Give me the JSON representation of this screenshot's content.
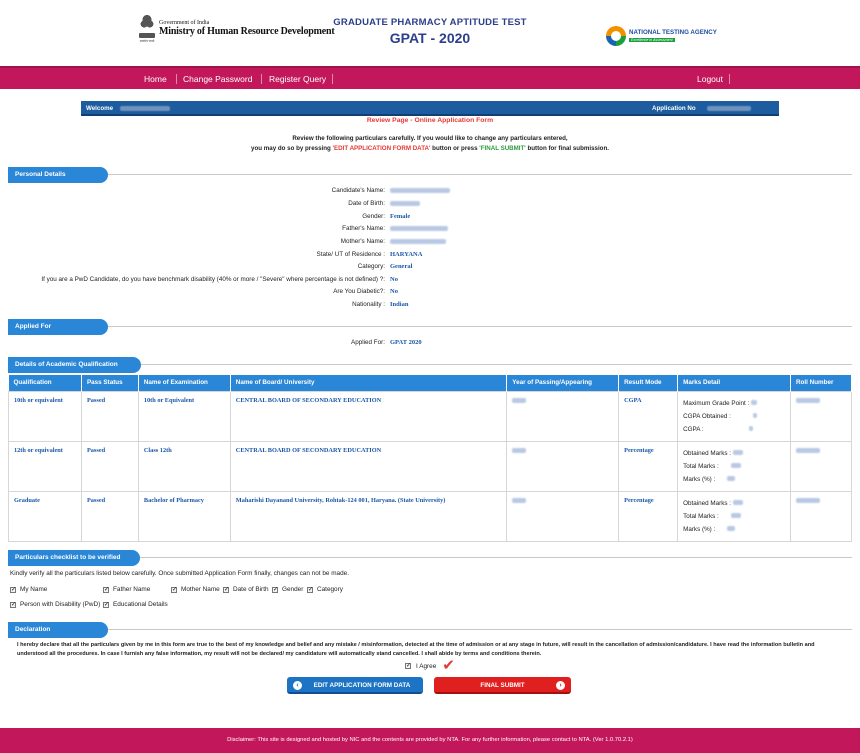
{
  "header": {
    "gov_line1": "Government of India",
    "gov_line2": "Ministry of Human Resource Development",
    "emblem_motto": "सत्यमेव जयते",
    "title_line1": "GRADUATE PHARMACY APTITUDE TEST",
    "title_line2": "GPAT - 2020",
    "nta_name": "NATIONAL TESTING AGENCY",
    "nta_tagline": "Excellence in Assessment"
  },
  "nav": {
    "home": "Home",
    "change_password": "Change Password",
    "register_query": "Register Query",
    "logout": "Logout"
  },
  "welcome_bar": {
    "welcome_label": "Welcome",
    "application_label": "Application No"
  },
  "review": {
    "title": "Review Page - Online Application Form",
    "instr_line1": "Review the following particulars carefully. If you would like to change any particulars entered,",
    "instr_part1": "you may do so by pressing ",
    "instr_edit": "'EDIT APPLICATION FORM DATA'",
    "instr_part2": " button or press ",
    "instr_final": "'FINAL SUBMIT'",
    "instr_part3": " button for final submission."
  },
  "sections": {
    "personal": "Personal Details",
    "applied_for": "Applied For",
    "academic": "Details of Academic Qualification",
    "checklist": "Particulars checklist to be verified",
    "declaration": "Declaration"
  },
  "personal": {
    "candidate_name_label": "Candidate's Name:",
    "dob_label": "Date of Birth:",
    "gender_label": "Gender:",
    "gender_value": "Female",
    "father_label": "Father's Name:",
    "mother_label": "Mother's Name:",
    "state_label": "State/ UT of Residence :",
    "state_value": "HARYANA",
    "category_label": "Category:",
    "category_value": "General",
    "pwd_label": "If you are a PwD Candidate, do you have benchmark disability (40% or more / \"Severe\" where percentage is not defined) ?:",
    "pwd_value": "No",
    "diabetic_label": "Are You Diabetic?:",
    "diabetic_value": "No",
    "nationality_label": "Nationality :",
    "nationality_value": "Indian"
  },
  "applied": {
    "label": "Applied For:",
    "value": "GPAT 2020"
  },
  "table": {
    "headers": [
      "Qualification",
      "Pass Status",
      "Name of Examination",
      "Name of Board/ University",
      "Year of Passing/Appearing",
      "Result Mode",
      "Marks Detail",
      "Roll Number"
    ],
    "rows": [
      {
        "qualification": "10th or equivalent",
        "status": "Passed",
        "exam": "10th or Equivalent",
        "board": "CENTRAL BOARD OF SECONDARY EDUCATION",
        "mode": "CGPA",
        "marks": [
          "Maximum Grade Point :",
          "CGPA Obtained :",
          "CGPA :"
        ]
      },
      {
        "qualification": "12th or equivalent",
        "status": "Passed",
        "exam": "Class 12th",
        "board": "CENTRAL BOARD OF SECONDARY EDUCATION",
        "mode": "Percentage",
        "marks": [
          "Obtained Marks :",
          "Total Marks :",
          "Marks (%) :"
        ]
      },
      {
        "qualification": "Graduate",
        "status": "Passed",
        "exam": "Bachelor of Pharmacy",
        "board": "Maharishi Dayanand University, Rohtak-124 001, Haryana. (State University)",
        "mode": "Percentage",
        "marks": [
          "Obtained Marks :",
          "Total Marks :",
          "Marks (%) :"
        ]
      }
    ]
  },
  "checklist": {
    "intro": "Kindly verify all the particulars listed below carefully. Once submitted Application Form finally, changes can not be made.",
    "items": [
      "My Name",
      "Father Name",
      "Mother Name",
      "Date of Birth",
      "Gender",
      "Category",
      "Person with Disability (PwD)",
      "Educational Details"
    ]
  },
  "declaration": {
    "text": "I hereby declare that all the particulars given by me in this form are true to the best of my knowledge and belief and any mistake / misinformation, detected at the time of admission or at any stage in future, will result in the cancellation of admission/candidature. I have read the information bulletin and understood all the procedures. In case I furnish any false information, my result will not be declared/ my candidature will automatically stand cancelled. I shall abide by terms and conditions therein.",
    "agree_label": "I Agree"
  },
  "buttons": {
    "edit": "EDIT APPLICATION FORM DATA",
    "final": "FINAL SUBMIT"
  },
  "footer": {
    "disclaimer": "Disclaimer: This site is designed and hosted by NIC and the contents are provided by NTA. For any further information, please contact to NTA. (Ver 1.0.70.2.1)"
  },
  "colors": {
    "brand_magenta": "#c2185b",
    "header_blue": "#2a86d6",
    "welcome_blue": "#1d5c9e",
    "value_blue": "#1b57a8",
    "accent_red": "#e53935"
  }
}
